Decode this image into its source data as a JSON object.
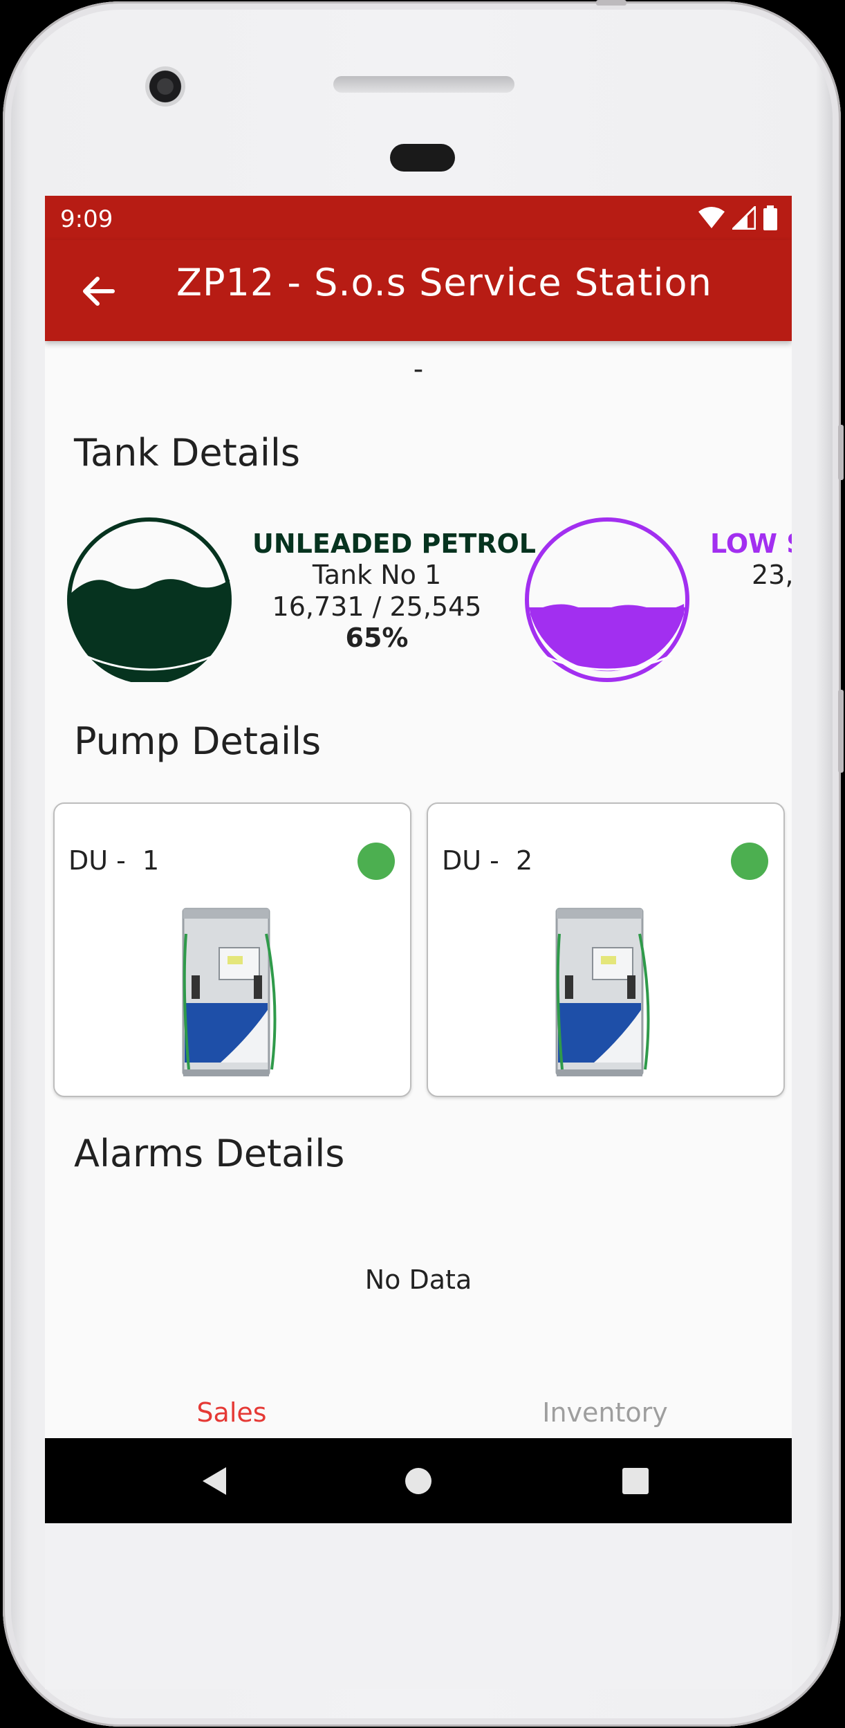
{
  "status_bar": {
    "time": "9:09",
    "icons": [
      "wifi-icon",
      "signal-icon",
      "battery-icon"
    ]
  },
  "app_bar": {
    "title": "ZP12 - S.o.s Service Station",
    "back_icon": "arrow-left-icon"
  },
  "subtitle": "-",
  "sections": {
    "tanks_title": "Tank Details",
    "pumps_title": "Pump Details",
    "alarms_title": "Alarms Details"
  },
  "tanks": [
    {
      "product": "UNLEADED PETROL",
      "tank_no": "Tank No 1",
      "volume": "16,731 / 25,545",
      "percent": "65%",
      "fill_fraction": 0.65,
      "color": "#06331f"
    },
    {
      "product": "LOW S",
      "tank_no": "",
      "volume": "23,",
      "percent": "",
      "fill_fraction": 0.5,
      "color": "#a22ff0"
    }
  ],
  "pumps": [
    {
      "label": "DU -  1",
      "status_color": "#4caf50"
    },
    {
      "label": "DU -  2",
      "status_color": "#4caf50"
    }
  ],
  "alarms": {
    "empty_text": "No Data"
  },
  "tabs": [
    {
      "label": "Sales",
      "color": "#e53935"
    },
    {
      "label": "Inventory",
      "color": "#9e9e9e"
    }
  ],
  "colors": {
    "primary": "#b71c14",
    "status_ok": "#4caf50"
  }
}
